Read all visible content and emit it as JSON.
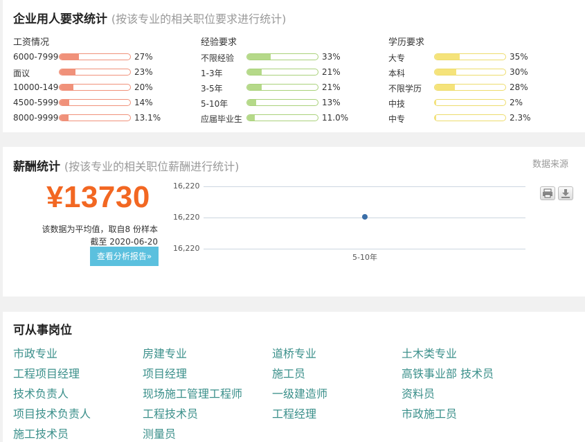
{
  "requirements": {
    "title": "企业用人要求统计",
    "subtitle": "(按该专业的相关职位要求进行统计)",
    "columns": [
      {
        "title": "工资情况",
        "color": "#f0917a",
        "border": "#f0917a",
        "rows": [
          {
            "label": "6000-7999",
            "pct": "27%",
            "value": 27
          },
          {
            "label": "面议",
            "pct": "23%",
            "value": 23
          },
          {
            "label": "10000-14999",
            "pct": "20%",
            "value": 20
          },
          {
            "label": "4500-5999",
            "pct": "14%",
            "value": 14
          },
          {
            "label": "8000-9999",
            "pct": "13.1%",
            "value": 13.1
          }
        ]
      },
      {
        "title": "经验要求",
        "color": "#b5d989",
        "border": "#a9d17a",
        "rows": [
          {
            "label": "不限经验",
            "pct": "33%",
            "value": 33
          },
          {
            "label": "1-3年",
            "pct": "21%",
            "value": 21
          },
          {
            "label": "3-5年",
            "pct": "21%",
            "value": 21
          },
          {
            "label": "5-10年",
            "pct": "13%",
            "value": 13
          },
          {
            "label": "应届毕业生",
            "pct": "11.0%",
            "value": 11
          }
        ]
      },
      {
        "title": "学历要求",
        "color": "#f5e37a",
        "border": "#eddc6c",
        "rows": [
          {
            "label": "大专",
            "pct": "35%",
            "value": 35
          },
          {
            "label": "本科",
            "pct": "30%",
            "value": 30
          },
          {
            "label": "不限学历",
            "pct": "28%",
            "value": 28
          },
          {
            "label": "中技",
            "pct": "2%",
            "value": 2
          },
          {
            "label": "中专",
            "pct": "2.3%",
            "value": 2.3
          }
        ]
      }
    ]
  },
  "salary": {
    "title": "薪酬统计",
    "subtitle": "(按该专业的相关职位薪酬进行统计)",
    "source_link": "数据来源",
    "amount": "¥13730",
    "note": "该数据为平均值，取自8 份样本",
    "date": "截至 2020-06-20",
    "report_button": "查看分析报告»",
    "print_icon": "print-icon",
    "download_icon": "download-icon",
    "chart_data": {
      "type": "line",
      "x": [
        "5-10年"
      ],
      "series": [
        {
          "values": [
            16220
          ]
        }
      ],
      "ytick_labels": [
        "16,220",
        "16,220",
        "16,220"
      ],
      "grid": true
    }
  },
  "jobs": {
    "title": "可从事岗位",
    "items": [
      "市政专业",
      "房建专业",
      "道桥专业",
      "土木类专业",
      "工程项目经理",
      "项目经理",
      "施工员",
      "高铁事业部 技术员",
      "技术负责人",
      "现场施工管理工程师",
      "一级建造师",
      "资料员",
      "项目技术负责人",
      "工程技术员",
      "工程经理",
      "市政施工员",
      "施工技术员",
      "测量员"
    ]
  }
}
